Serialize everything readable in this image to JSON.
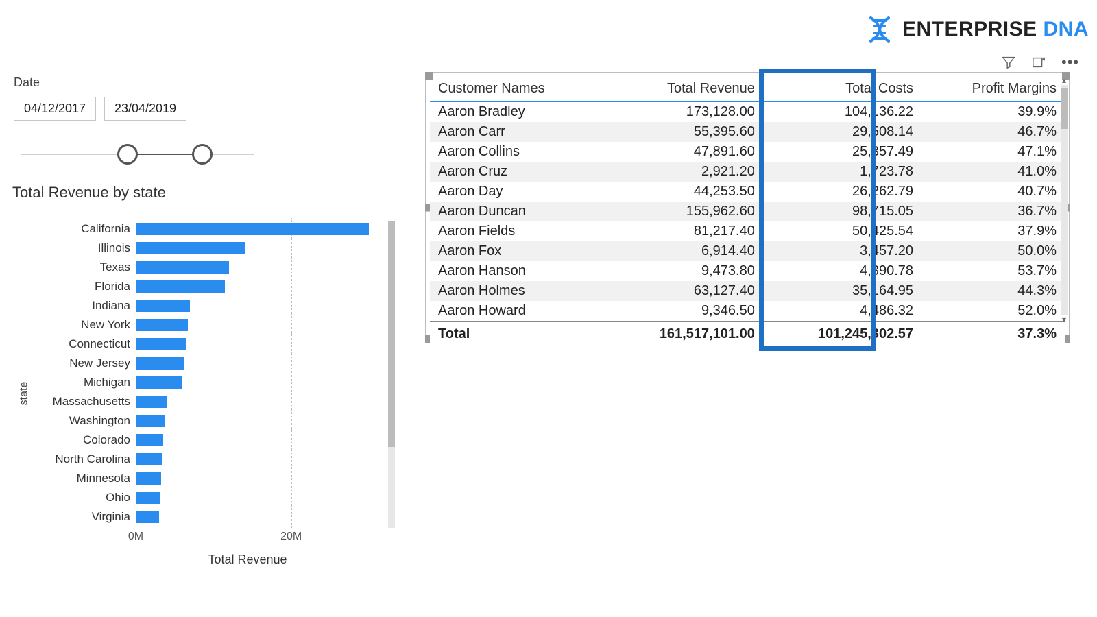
{
  "brand": {
    "name1": "ENTERPRISE",
    "name2": "DNA"
  },
  "date_slicer": {
    "label": "Date",
    "from": "04/12/2017",
    "to": "23/04/2019"
  },
  "chart_title": "Total Revenue by state",
  "y_axis_title": "state",
  "x_axis_title": "Total Revenue",
  "x_ticks": [
    "0M",
    "20M"
  ],
  "chart_data": {
    "type": "bar",
    "title": "Total Revenue by state",
    "xlabel": "Total Revenue",
    "ylabel": "state",
    "xlim": [
      0,
      30000000
    ],
    "categories": [
      "California",
      "Illinois",
      "Texas",
      "Florida",
      "Indiana",
      "New York",
      "Connecticut",
      "New Jersey",
      "Michigan",
      "Massachusetts",
      "Washington",
      "Colorado",
      "North Carolina",
      "Minnesota",
      "Ohio",
      "Virginia"
    ],
    "values": [
      30000000,
      14000000,
      12000000,
      11500000,
      7000000,
      6700000,
      6400000,
      6200000,
      6000000,
      4000000,
      3800000,
      3500000,
      3400000,
      3300000,
      3200000,
      3000000
    ],
    "x_ticks": [
      0,
      20000000
    ]
  },
  "table": {
    "headers": [
      "Customer Names",
      "Total Revenue",
      "Total Costs",
      "Profit Margins"
    ],
    "rows": [
      [
        "Aaron Bradley",
        "173,128.00",
        "104,136.22",
        "39.9%"
      ],
      [
        "Aaron Carr",
        "55,395.60",
        "29,508.14",
        "46.7%"
      ],
      [
        "Aaron Collins",
        "47,891.60",
        "25,357.49",
        "47.1%"
      ],
      [
        "Aaron Cruz",
        "2,921.20",
        "1,723.78",
        "41.0%"
      ],
      [
        "Aaron Day",
        "44,253.50",
        "26,262.79",
        "40.7%"
      ],
      [
        "Aaron Duncan",
        "155,962.60",
        "98,715.05",
        "36.7%"
      ],
      [
        "Aaron Fields",
        "81,217.40",
        "50,425.54",
        "37.9%"
      ],
      [
        "Aaron Fox",
        "6,914.40",
        "3,457.20",
        "50.0%"
      ],
      [
        "Aaron Hanson",
        "9,473.80",
        "4,390.78",
        "53.7%"
      ],
      [
        "Aaron Holmes",
        "63,127.40",
        "35,164.95",
        "44.3%"
      ],
      [
        "Aaron Howard",
        "9,346.50",
        "4,486.32",
        "52.0%"
      ]
    ],
    "total": [
      "Total",
      "161,517,101.00",
      "101,245,302.57",
      "37.3%"
    ]
  }
}
